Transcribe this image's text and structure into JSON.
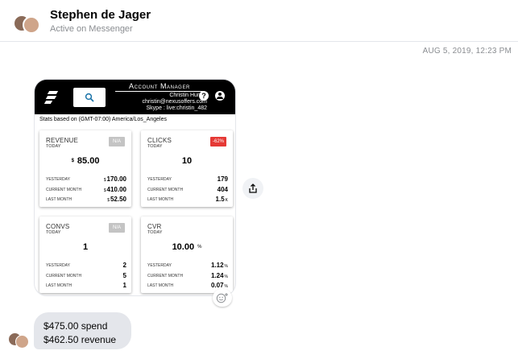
{
  "header": {
    "contact_name": "Stephen de Jager",
    "status": "Active on Messenger"
  },
  "timestamp": "AUG 5, 2019, 12:23 PM",
  "shared_image": {
    "title": "Account Manager",
    "manager_name": "Christin Hunter",
    "manager_email": "christin@nexusoffers.com",
    "manager_skype": "Skype : live:christin_482",
    "help_icon": "?",
    "stats_note": "Stats based on (GMT-07:00) America/Los_Angeles",
    "cards": [
      {
        "title": "REVENUE",
        "subtitle": "TODAY",
        "badge": "N/A",
        "badge_color": "#c4c4c4",
        "currency": "$",
        "main_value": "85.00",
        "unit": "",
        "rows": [
          {
            "label": "YESTERDAY",
            "currency": "$",
            "value": "170.00",
            "suffix": ""
          },
          {
            "label": "CURRENT MONTH",
            "currency": "$",
            "value": "410.00",
            "suffix": ""
          },
          {
            "label": "LAST MONTH",
            "currency": "$",
            "value": "52.50",
            "suffix": ""
          }
        ]
      },
      {
        "title": "CLICKS",
        "subtitle": "TODAY",
        "badge": "-62%",
        "badge_color": "#e53935",
        "currency": "",
        "main_value": "10",
        "unit": "",
        "rows": [
          {
            "label": "YESTERDAY",
            "currency": "",
            "value": "179",
            "suffix": ""
          },
          {
            "label": "CURRENT MONTH",
            "currency": "",
            "value": "404",
            "suffix": ""
          },
          {
            "label": "LAST MONTH",
            "currency": "",
            "value": "1.5",
            "suffix": "K"
          }
        ]
      },
      {
        "title": "CONVS",
        "subtitle": "TODAY",
        "badge": "N/A",
        "badge_color": "#c4c4c4",
        "currency": "",
        "main_value": "1",
        "unit": "",
        "rows": [
          {
            "label": "YESTERDAY",
            "currency": "",
            "value": "2",
            "suffix": ""
          },
          {
            "label": "CURRENT MONTH",
            "currency": "",
            "value": "5",
            "suffix": ""
          },
          {
            "label": "LAST MONTH",
            "currency": "",
            "value": "1",
            "suffix": ""
          }
        ]
      },
      {
        "title": "CVR",
        "subtitle": "TODAY",
        "badge": "",
        "badge_color": "",
        "currency": "",
        "main_value": "10.00",
        "unit": "%",
        "rows": [
          {
            "label": "YESTERDAY",
            "currency": "",
            "value": "1.12",
            "suffix": "%"
          },
          {
            "label": "CURRENT MONTH",
            "currency": "",
            "value": "1.24",
            "suffix": "%"
          },
          {
            "label": "LAST MONTH",
            "currency": "",
            "value": "0.07",
            "suffix": "%"
          }
        ]
      }
    ]
  },
  "message": {
    "line1": "$475.00 spend",
    "line2": "$462.50 revenue"
  },
  "icons": {
    "share": "share-icon",
    "reaction": "smiley-add-icon",
    "search": "search-icon",
    "help": "help-icon",
    "user": "user-icon",
    "logo": "brand-logo-icon"
  }
}
